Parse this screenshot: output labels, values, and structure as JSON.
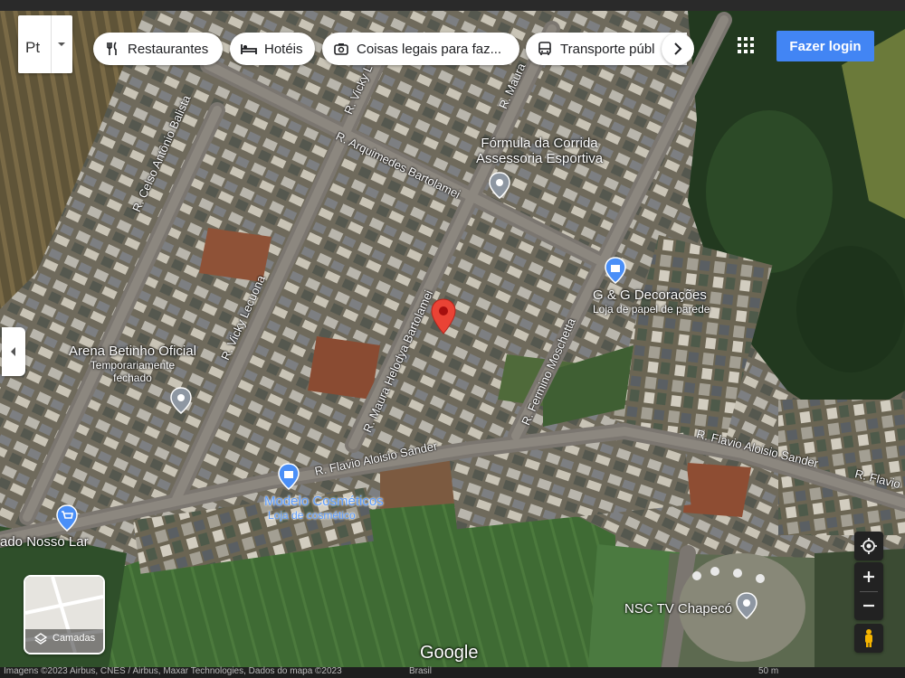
{
  "search": {
    "value": "Pt"
  },
  "chips": [
    {
      "label": "Restaurantes",
      "icon": "fork-knife-icon"
    },
    {
      "label": "Hotéis",
      "icon": "bed-icon"
    },
    {
      "label": "Coisas legais para faz...",
      "icon": "camera-icon"
    },
    {
      "label": "Transporte públ",
      "icon": "bus-icon"
    }
  ],
  "login": {
    "label": "Fazer login",
    "color": "#4285f4"
  },
  "streets": {
    "s1": "R. Celso Antônio Balista",
    "s2": "R. Vicky L",
    "s3": "R. Maura",
    "s4": "R. Arquimedes Bartolamei",
    "s5": "R. Vicky Lecuona",
    "s6": "R. Maura Helodya Bartolamei",
    "s7": "R. Fermino Moschetta",
    "s8": "R. Flavio Aloisio Sander",
    "s9": "R. Flavio Aloisio Sander",
    "s10": "R. Flavio"
  },
  "places": {
    "p1": {
      "name": "Fórmula da Corrida",
      "name2": "Assessoria Esportiva"
    },
    "p2": {
      "name": "G & G Decorações",
      "sub": "Loja de papel de parede"
    },
    "p3": {
      "name": "Arena Betinho Oficial",
      "sub": "Temporariamente",
      "sub2": "fechado"
    },
    "p4": {
      "name": "Modelo Cosméticos",
      "sub": "Loja de cosmético"
    },
    "p5": {
      "name": "ado Nosso Lar"
    },
    "p6": {
      "name": "NSC TV Chapecó"
    }
  },
  "layers": {
    "label": "Camadas"
  },
  "logo": "Google",
  "attribution": "Imagens ©2023 Airbus, CNES / Airbus, Maxar Technologies, Dados do mapa ©2023",
  "region": "Brasil",
  "scale": "50 m",
  "colors": {
    "pin": "#ea4335",
    "poi_blue": "#4a8ff7",
    "poi_gray": "#8e97a2"
  }
}
